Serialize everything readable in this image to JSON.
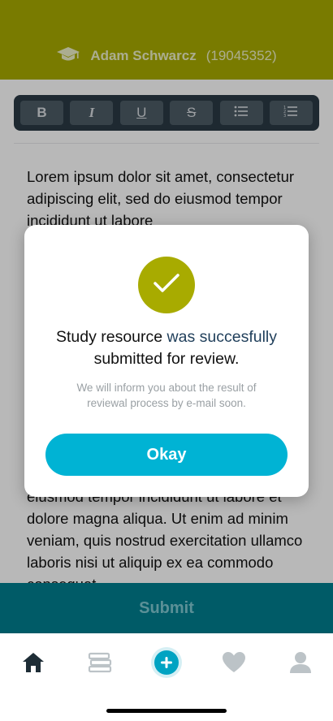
{
  "header": {
    "user_name": "Adam Schwarcz",
    "user_id": "(19045352)",
    "icon": "graduation-cap-icon"
  },
  "toolbar": {
    "bold_label": "B",
    "italic_label": "I",
    "underline_label": "U",
    "strike_label": "S",
    "bullet_icon": "bullet-list-icon",
    "numbered_icon": "numbered-list-icon"
  },
  "editor": {
    "text_top": "Lorem ipsum dolor sit amet, consectetur adipiscing elit, sed do eiusmod tempor incididunt ut labore",
    "text_bottom": "eiusmod tempor incididunt ut labore et dolore magna aliqua. Ut enim ad minim veniam, quis nostrud exercitation ullamco laboris nisi ut aliquip ex ea commodo consequat"
  },
  "submit": {
    "label": "Submit"
  },
  "modal": {
    "icon": "checkmark-icon",
    "title_part1": "Study resource",
    "title_part2": "was succesfully",
    "title_part3": "submitted for review.",
    "subtitle": "We will inform you about the result of reviewal process by e-mail soon.",
    "okay_label": "Okay"
  },
  "nav": {
    "items": [
      "home-icon",
      "books-icon",
      "add-icon",
      "heart-icon",
      "profile-icon"
    ]
  },
  "colors": {
    "brand_olive": "#a8ab00",
    "teal_dark": "#007f8f",
    "cyan": "#00b3d4",
    "toolbar_dark": "#2a3a44"
  }
}
